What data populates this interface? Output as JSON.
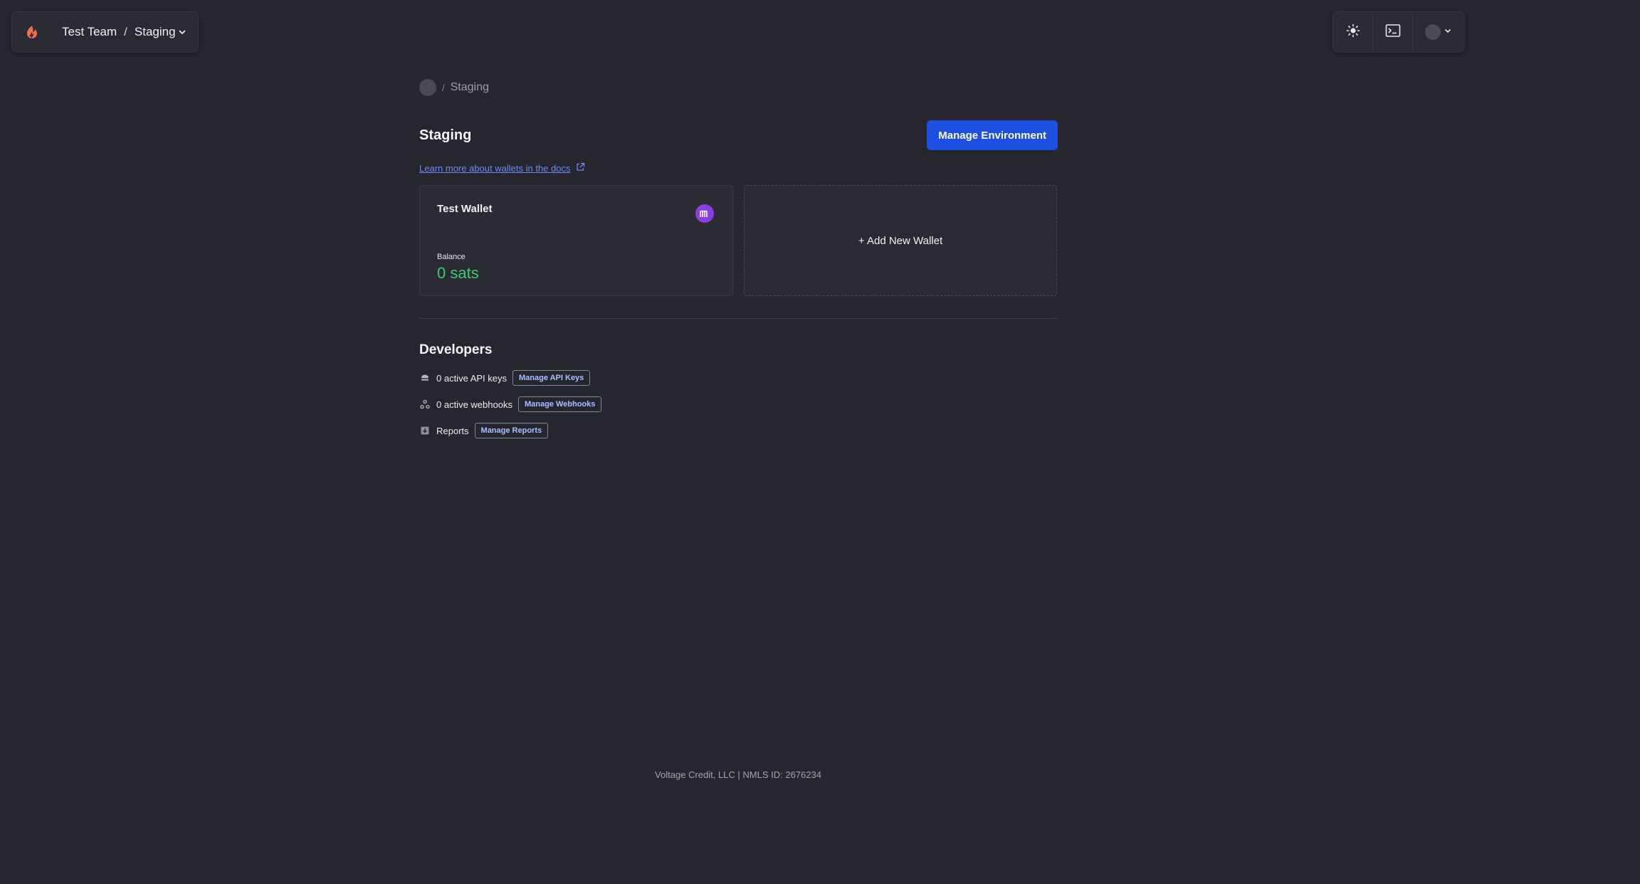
{
  "header": {
    "team": "Test Team",
    "separator": "/",
    "environment": "Staging",
    "icons": {
      "logo": "voltage-logo-icon",
      "switcher": "chevron-down-icon",
      "theme": "sun-icon",
      "terminal": "terminal-icon",
      "account": "chevron-down-icon"
    }
  },
  "breadcrumb": {
    "separator": "/",
    "current": "Staging"
  },
  "page": {
    "title": "Staging",
    "manage_button": "Manage Environment",
    "docs_link": "Learn more about wallets in the docs"
  },
  "wallets": {
    "items": [
      {
        "name": "Test Wallet",
        "balance_label": "Balance",
        "balance": "0 sats",
        "badge_icon": "m-badge-icon"
      }
    ],
    "add_label": "+ Add New Wallet"
  },
  "developers": {
    "title": "Developers",
    "items": [
      {
        "label": "0 active API keys",
        "action": "Manage API Keys",
        "icon": "key-icon"
      },
      {
        "label": "0 active webhooks",
        "action": "Manage Webhooks",
        "icon": "webhook-icon"
      },
      {
        "label": "Reports",
        "action": "Manage Reports",
        "icon": "report-icon"
      }
    ]
  },
  "footer": {
    "text": "Voltage Credit, LLC | NMLS ID: 2676234"
  },
  "colors": {
    "background": "#26262f",
    "primary": "#1d4fe0",
    "balance": "#3bcb72",
    "link": "#6d8cf2",
    "logo": "#f26a4f",
    "badge": "#8a3fe0"
  }
}
